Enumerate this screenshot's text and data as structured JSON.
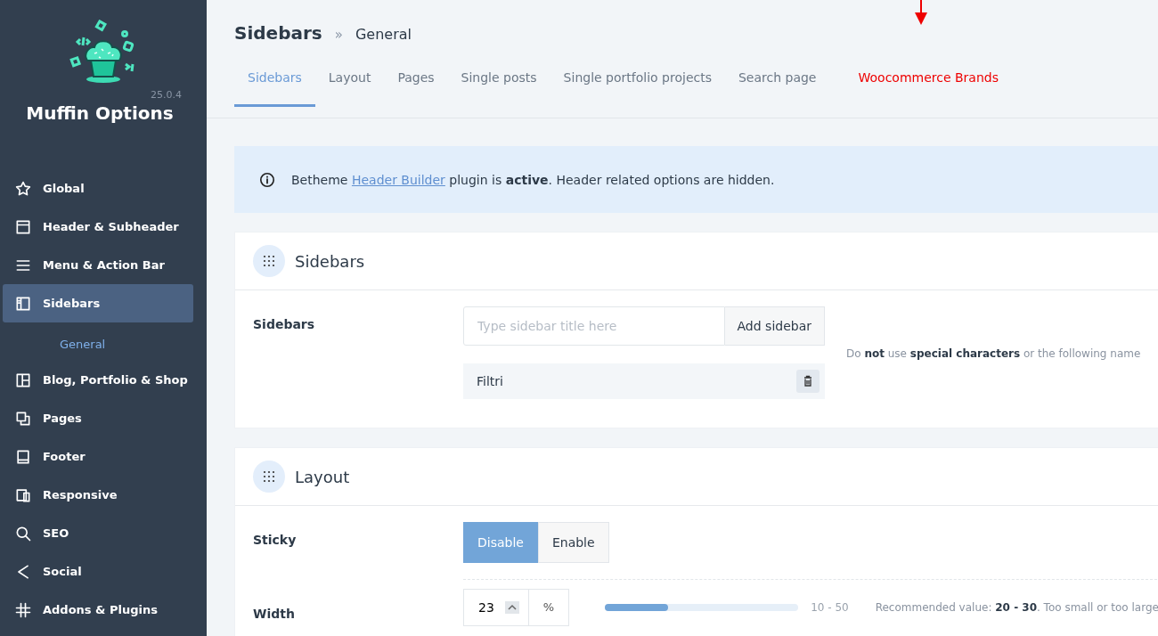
{
  "sidebar": {
    "version": "25.0.4",
    "title": "Muffin Options",
    "items": [
      {
        "label": "Global",
        "selected": false
      },
      {
        "label": "Header & Subheader",
        "selected": false
      },
      {
        "label": "Menu & Action Bar",
        "selected": false
      },
      {
        "label": "Sidebars",
        "selected": true,
        "children": [
          {
            "label": "General",
            "selected": true
          }
        ]
      },
      {
        "label": "Blog, Portfolio & Shop",
        "selected": false
      },
      {
        "label": "Pages",
        "selected": false
      },
      {
        "label": "Footer",
        "selected": false
      },
      {
        "label": "Responsive",
        "selected": false
      },
      {
        "label": "SEO",
        "selected": false
      },
      {
        "label": "Social",
        "selected": false
      },
      {
        "label": "Addons & Plugins",
        "selected": false
      }
    ]
  },
  "breadcrumb": {
    "title": "Sidebars",
    "separator": "»",
    "current": "General"
  },
  "tabs": [
    {
      "label": "Sidebars",
      "selected": true,
      "annotated": false
    },
    {
      "label": "Layout",
      "selected": false,
      "annotated": false
    },
    {
      "label": "Pages",
      "selected": false,
      "annotated": false
    },
    {
      "label": "Single posts",
      "selected": false,
      "annotated": false
    },
    {
      "label": "Single portfolio projects",
      "selected": false,
      "annotated": false
    },
    {
      "label": "Search page",
      "selected": false,
      "annotated": false
    },
    {
      "label": "Woocommerce Brands",
      "selected": false,
      "annotated": true
    }
  ],
  "notice": {
    "before": "Betheme ",
    "link": "Header Builder",
    "after": " plugin is **active**. Header related options are hidden."
  },
  "sections": [
    {
      "title": "Sidebars",
      "rows": [
        {
          "kind": "sidebar-list",
          "label": "Sidebars",
          "placeholder": "Type sidebar title here",
          "button": "Add sidebar",
          "entries": [
            "Filtri"
          ],
          "hint": "Do **not** use **special characters** or the following name"
        }
      ]
    },
    {
      "title": "Layout",
      "rows": [
        {
          "kind": "segmented",
          "label": "Sticky",
          "options": [
            {
              "label": "Disable",
              "selected": true
            },
            {
              "label": "Enable",
              "selected": false
            }
          ]
        },
        {
          "kind": "slider",
          "label": "Width",
          "value": "23",
          "unit": "%",
          "level": 0.325,
          "range": "10 - 50",
          "hint": "Recommended value: **20 - 30**. Too small or too large"
        }
      ]
    }
  ]
}
